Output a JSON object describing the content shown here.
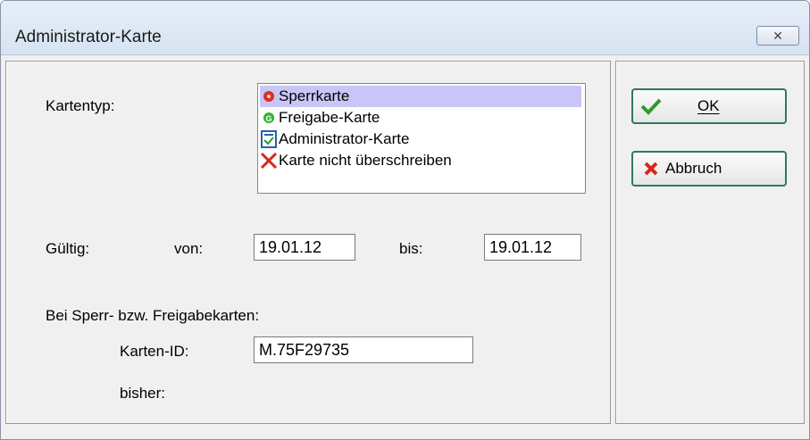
{
  "window": {
    "title": "Administrator-Karte",
    "close_icon": "close-icon"
  },
  "form": {
    "card_type_label": "Kartentyp:",
    "card_types": [
      {
        "label": "Sperrkarte",
        "icon": "red-dot-icon",
        "selected": true
      },
      {
        "label": "Freigabe-Karte",
        "icon": "green-g-icon",
        "selected": false
      },
      {
        "label": "Administrator-Karte",
        "icon": "admin-card-icon",
        "selected": false
      },
      {
        "label": "Karte nicht überschreiben",
        "icon": "red-x-icon",
        "selected": false
      }
    ],
    "valid_label": "Gültig:",
    "from_label": "von:",
    "from_value": "19.01.12",
    "to_label": "bis:",
    "to_value": "19.01.12",
    "section_label": "Bei Sperr- bzw. Freigabekarten:",
    "card_id_label": "Karten-ID:",
    "card_id_value": "M.75F29735",
    "previous_label": "bisher:"
  },
  "buttons": {
    "ok_label": "OK",
    "cancel_label": "Abbruch"
  },
  "colors": {
    "selection": "#c9c6f7",
    "button_border": "#2f7a57"
  }
}
